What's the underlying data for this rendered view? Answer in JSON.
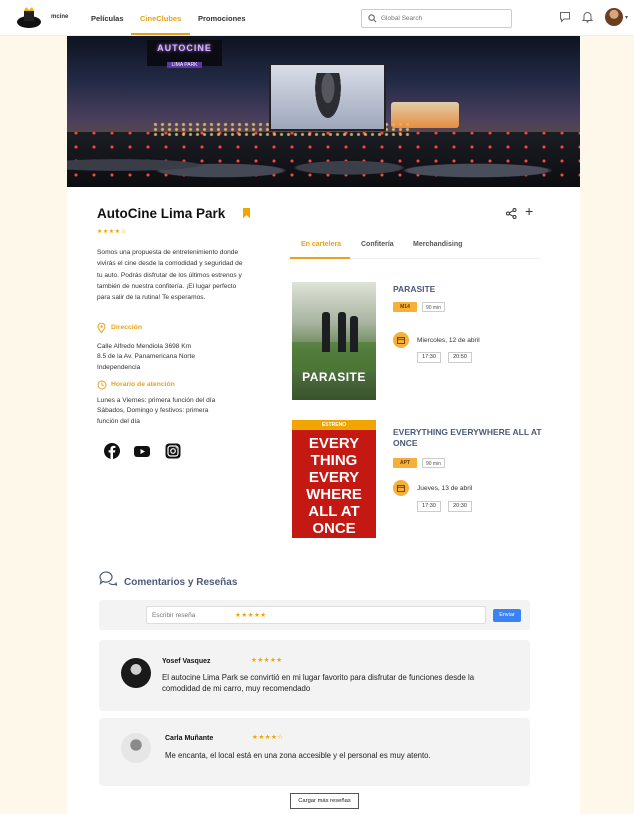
{
  "header": {
    "brand": "mcine",
    "nav": [
      "Películas",
      "CineClubes",
      "Promociones"
    ],
    "search_placeholder": "Global Search"
  },
  "club": {
    "hero_logo_line1": "AUTOCINE",
    "hero_logo_line2": "LIMA PARK",
    "name": "AutoCine Lima Park",
    "rating_stars": "★★★★☆",
    "description": "Somos una propuesta de entretenimiento donde vivirás el cine desde la comodidad y seguridad de tu auto. Podrás disfrutar de los últimos estrenos y también de nuestra confitería. ¡El lugar perfecto para salir de la rutina! Te esperamos.",
    "address_label": "Dirección",
    "address_lines": [
      "Calle Alfredo Mendiola 3698 Km",
      "8.5 de la Av. Panamericana Norte",
      "Independencia"
    ],
    "hours_label": "Horario de atención",
    "hours_lines": [
      "Lunes a Viernes: primera función del día",
      "Sábados, Domingo y festivos: primera",
      "función del día"
    ]
  },
  "tabs": [
    "En cartelera",
    "Confitería",
    "Merchandising"
  ],
  "movies": [
    {
      "title": "PARASITE",
      "poster_title": "PARASITE",
      "rating": "M14",
      "duration": "90 min",
      "date": "Miercoles, 12 de abril",
      "times": [
        "17:30",
        "20:50"
      ]
    },
    {
      "title": "EVERYTHING EVERYWHERE ALL AT ONCE",
      "poster_badge": "ESTRENO",
      "poster_title": "EVERY THING EVERY WHERE ALL AT ONCE",
      "rating": "APT",
      "duration": "90 min",
      "date": "Jueves, 13 de abril",
      "times": [
        "17:30",
        "20:30"
      ]
    }
  ],
  "reviews": {
    "heading": "Comentarios y Reseñas",
    "input_placeholder": "Escribir reseña",
    "input_stars": "★★★★★",
    "send_label": "Enviar",
    "items": [
      {
        "name": "Yosef Vasquez",
        "stars": "★★★★★",
        "text": "El autocine Lima Park se convirtió en mi lugar favorito para disfrutar de funciones desde la comodidad de mi carro, muy recomendado"
      },
      {
        "name": "Carla Muñante",
        "stars": "★★★★☆",
        "text": "Me encanta, el local está en una zona accesible y el personal es muy atento."
      }
    ],
    "more_label": "Cargar más reseñas"
  }
}
